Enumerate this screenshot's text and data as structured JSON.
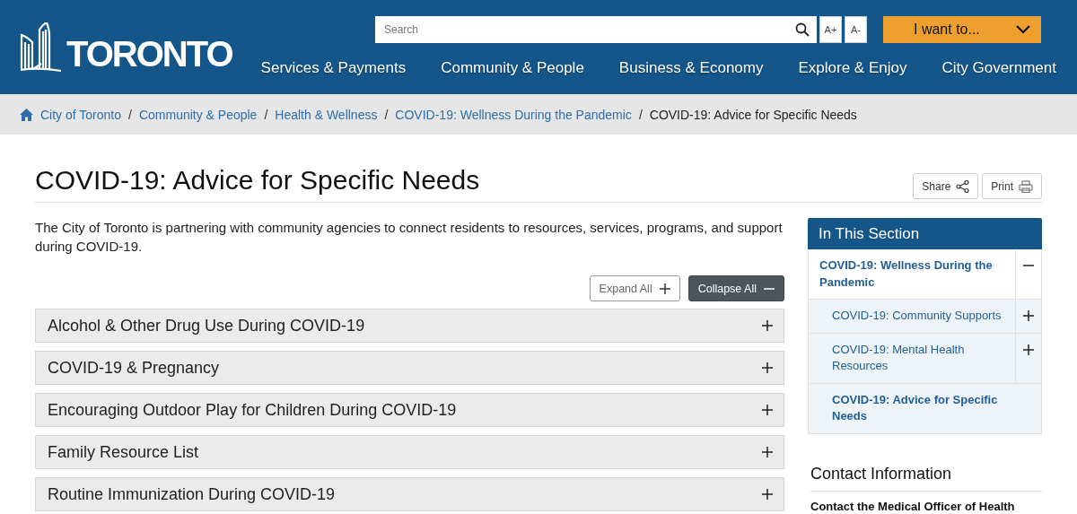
{
  "header": {
    "logo_text": "TORONTO",
    "search": {
      "placeholder": "Search"
    },
    "font_buttons": [
      "A+",
      "A-"
    ],
    "i_want_to": "I want to...",
    "nav": [
      "Services & Payments",
      "Community & People",
      "Business & Economy",
      "Explore & Enjoy",
      "City Government"
    ]
  },
  "breadcrumb_separator": "/",
  "breadcrumb": [
    {
      "label": "City of Toronto",
      "link": true
    },
    {
      "label": "Community & People",
      "link": true
    },
    {
      "label": "Health & Wellness",
      "link": true
    },
    {
      "label": "COVID-19: Wellness During the Pandemic",
      "link": true
    },
    {
      "label": "COVID-19: Advice for Specific Needs",
      "link": false
    }
  ],
  "page": {
    "title": "COVID-19: Advice for Specific Needs",
    "share": "Share",
    "print": "Print",
    "intro": "The City of Toronto is partnering with community agencies to connect residents to resources, services, programs, and support during COVID-19.",
    "expand_all": "Expand All",
    "collapse_all": "Collapse All",
    "accordion": [
      {
        "title": "Alcohol & Other Drug Use During COVID-19",
        "expanded": false
      },
      {
        "title": "COVID-19 & Pregnancy",
        "expanded": false
      },
      {
        "title": "Encouraging Outdoor Play for Children During COVID-19",
        "expanded": false
      },
      {
        "title": "Family Resource List",
        "expanded": false
      },
      {
        "title": "Routine Immunization During COVID-19",
        "expanded": false
      }
    ]
  },
  "sidebar": {
    "title": "In This Section",
    "items": [
      {
        "label": "COVID-19: Wellness During the Pandemic",
        "expanded": true,
        "children": [
          {
            "label": "COVID-19: Community Supports",
            "expanded": false,
            "selected": false
          },
          {
            "label": "COVID-19: Mental Health Resources",
            "expanded": false,
            "selected": false
          },
          {
            "label": "COVID-19: Advice for Specific Needs",
            "selected": true
          }
        ]
      }
    ],
    "contact_title": "Contact Information",
    "contact_text": "Contact the Medical Officer of Health"
  }
}
